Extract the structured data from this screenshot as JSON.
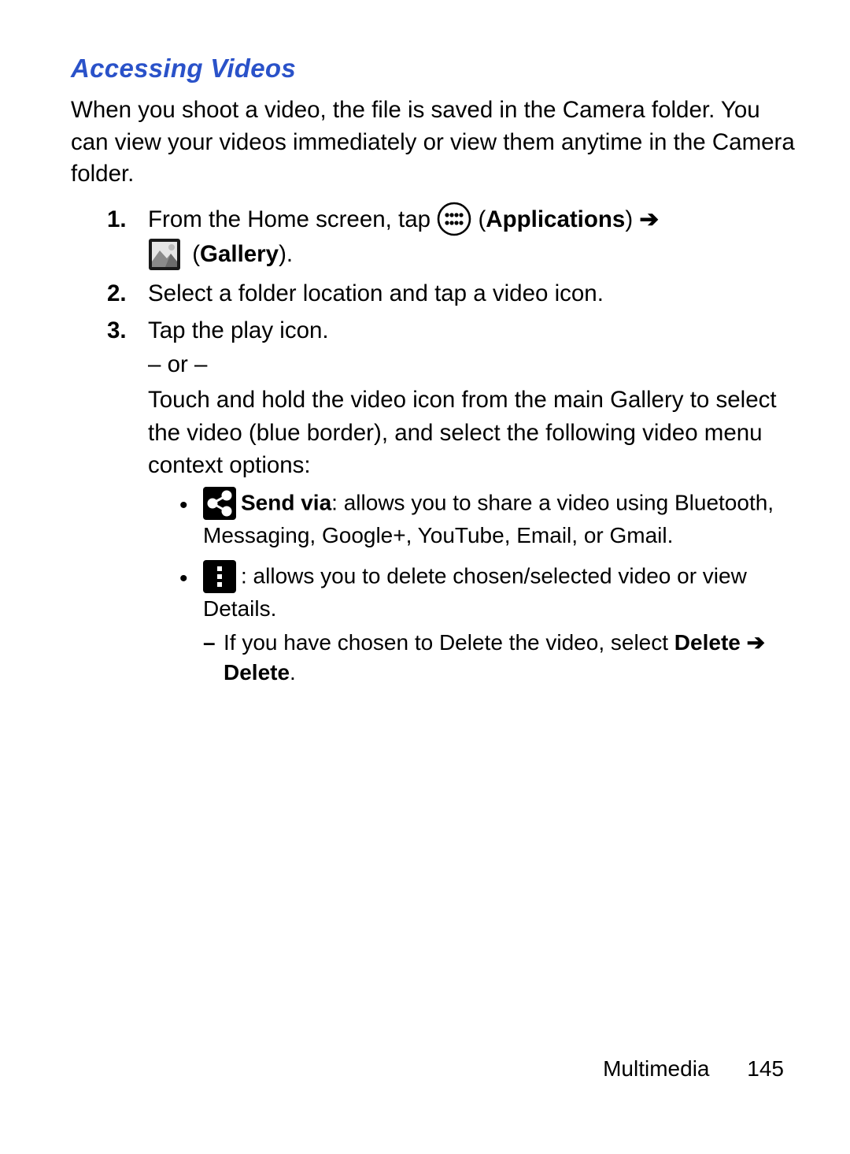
{
  "heading": "Accessing Videos",
  "intro": "When you shoot a video, the file is saved in the Camera folder. You can view your videos immediately or view them anytime in the Camera folder.",
  "steps": {
    "s1": {
      "num": "1.",
      "pre": "From the Home screen, tap ",
      "apps_lp": " (",
      "apps_label": "Applications",
      "apps_rp": ") ",
      "arrow": "➔",
      "gallery_lp": " (",
      "gallery_label": "Gallery",
      "gallery_rp": ")."
    },
    "s2": {
      "num": "2.",
      "text": "Select a folder location and tap a video icon."
    },
    "s3": {
      "num": "3.",
      "lead": "Tap the play icon.",
      "or": "– or –",
      "alt": "Touch and hold the video icon from the main Gallery to select the video (blue border), and select the following video menu context options:",
      "bul1": {
        "title": "Send via",
        "rest": ": allows you to share a video using Bluetooth, Messaging, Google+, YouTube, Email, or Gmail."
      },
      "bul2": {
        "rest": ": allows you to delete chosen/selected video or view Details.",
        "sub_pre": "If you have chosen to Delete the video, select ",
        "sub_b1": "Delete",
        "sub_arrow": " ➔ ",
        "sub_b2": "Delete",
        "sub_dot": "."
      }
    }
  },
  "footer": {
    "section": "Multimedia",
    "page": "145"
  }
}
